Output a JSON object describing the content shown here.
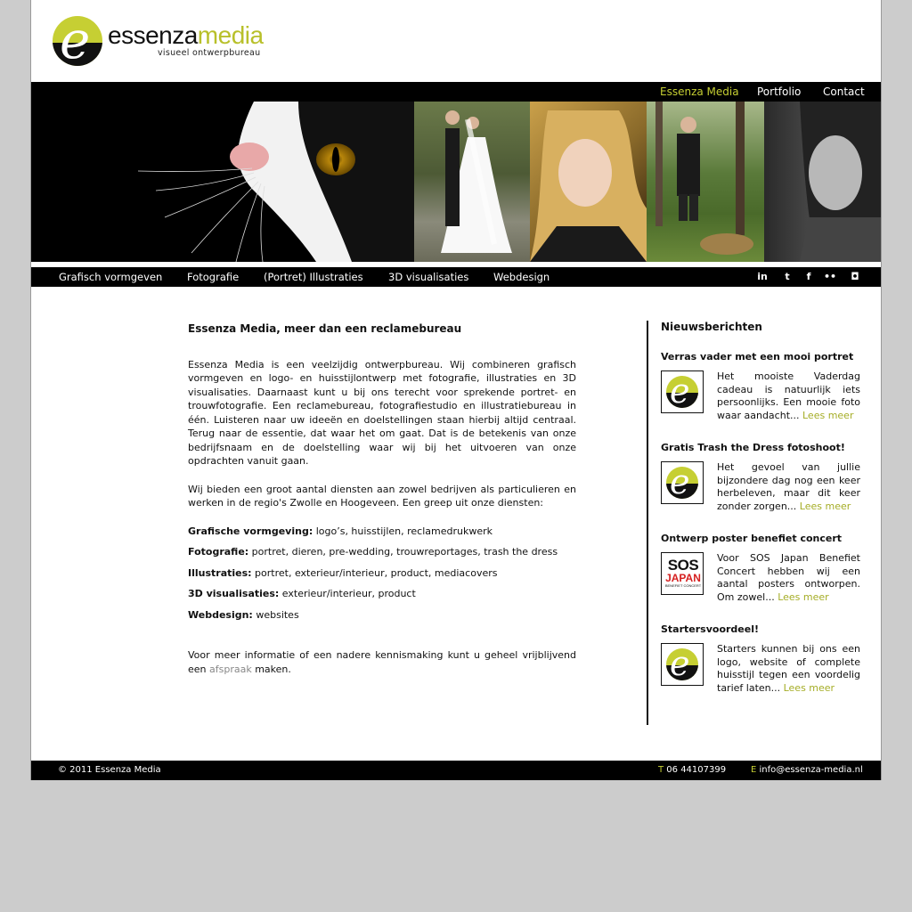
{
  "brand": {
    "name_part1": "essenza",
    "name_part2": "media",
    "tagline": "visueel ontwerpbureau",
    "logo_letter": "e",
    "accent_color": "#c6cf33"
  },
  "top_nav": [
    {
      "label": "Essenza Media",
      "active": true
    },
    {
      "label": "Portfolio",
      "active": false
    },
    {
      "label": "Contact",
      "active": false
    }
  ],
  "secondary_nav": [
    {
      "label": "Grafisch vormgeven"
    },
    {
      "label": "Fotografie"
    },
    {
      "label": "(Portret) Illustraties"
    },
    {
      "label": "3D visualisaties"
    },
    {
      "label": "Webdesign"
    }
  ],
  "social_icons": [
    "linkedin-icon",
    "twitter-icon",
    "facebook-icon",
    "flickr-icon",
    "camera-icon"
  ],
  "social_glyphs": {
    "linkedin": "in",
    "twitter": "t",
    "facebook": "f",
    "flickr": "••",
    "camera": "◘"
  },
  "main": {
    "title": "Essenza Media, meer dan een reclamebureau",
    "intro": "Essenza Media is een veelzijdig ontwerpbureau. Wij combineren grafisch vormgeven en logo- en huisstijlontwerp met fotografie, illustraties en 3D visualisaties. Daarnaast kunt u bij ons terecht voor sprekende portret- en trouwfotografie. Een reclamebureau, fotografiestudio en illustratiebureau in één. Luisteren naar uw ideeën en doelstellingen staan hierbij altijd centraal. Terug naar de essentie, dat waar het om gaat. Dat is de betekenis van onze bedrijfsnaam en de doelstelling waar wij bij het uitvoeren van onze opdrachten vanuit gaan.",
    "services_intro": "Wij bieden een groot aantal diensten aan zowel bedrijven als particulieren en werken in de regio's Zwolle en Hoogeveen. Een greep uit onze diensten:",
    "services": [
      {
        "label": "Grafische vormgeving:",
        "text": " logo’s, huisstijlen, reclamedrukwerk"
      },
      {
        "label": "Fotografie:",
        "text": " portret, dieren, pre-wedding, trouwreportages, trash the dress"
      },
      {
        "label": "Illustraties:",
        "text": " portret, exterieur/interieur, product, mediacovers"
      },
      {
        "label": "3D visualisaties:",
        "text": " exterieur/interieur, product"
      },
      {
        "label": "Webdesign:",
        "text": " websites"
      }
    ],
    "contact_pre": "Voor meer informatie of een nadere kennismaking kunt u geheel vrijblijvend een ",
    "contact_link": "afspraak",
    "contact_post": " maken."
  },
  "news": {
    "heading": "Nieuwsberichten",
    "read_more": "Lees meer",
    "items": [
      {
        "title": "Verras vader met een mooi portret",
        "text": "Het mooiste Vaderdag cadeau is natuurlijk iets persoonlijks. Een mooie foto waar aandacht... ",
        "thumb": "logo"
      },
      {
        "title": "Gratis Trash the Dress fotoshoot!",
        "text": "Het gevoel van jullie bijzondere dag nog een keer herbeleven, maar dit keer zonder zorgen... ",
        "thumb": "logo"
      },
      {
        "title": "Ontwerp poster benefiet concert",
        "text": "Voor SOS Japan Benefiet Concert hebben wij een aantal posters ontworpen. Om zowel... ",
        "thumb": "sos"
      },
      {
        "title": "Startersvoordeel!",
        "text": "Starters kunnen bij ons een logo, website of complete huisstijl tegen een voordelig tarief laten... ",
        "thumb": "logo"
      }
    ],
    "sos_thumb": {
      "line1": "SOS",
      "line2": "JAPAN",
      "line3": "BENEFIET CONCERT"
    }
  },
  "footer": {
    "copyright": "© 2011 Essenza Media",
    "tel_label": "T",
    "tel": " 06 44107399",
    "email_label": "E",
    "email": " info@essenza-media.nl"
  }
}
